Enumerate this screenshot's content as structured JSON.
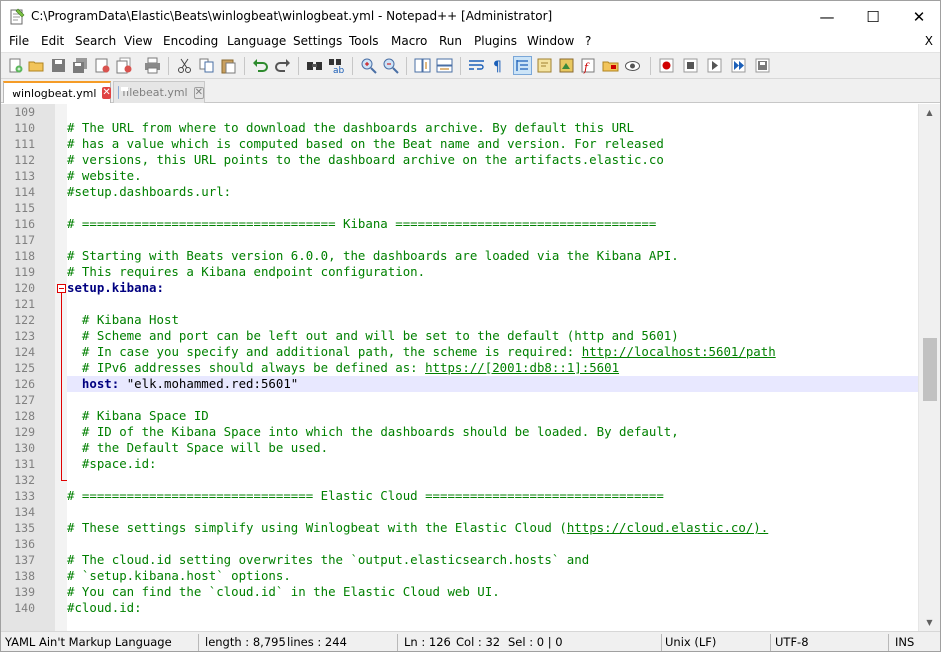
{
  "window": {
    "title": "C:\\ProgramData\\Elastic\\Beats\\winlogbeat\\winlogbeat.yml - Notepad++ [Administrator]",
    "minimize": "—",
    "maximize": "☐",
    "close": "✕"
  },
  "menu": {
    "items": [
      "File",
      "Edit",
      "Search",
      "View",
      "Encoding",
      "Language",
      "Settings",
      "Tools",
      "Macro",
      "Run",
      "Plugins",
      "Window",
      "?"
    ],
    "close": "X"
  },
  "toolbar": {
    "icons": [
      "new-file-icon",
      "open-file-icon",
      "save-icon",
      "save-all-icon",
      "close-icon",
      "close-all-icon",
      "print-icon",
      "cut-icon",
      "copy-icon",
      "paste-icon",
      "undo-icon",
      "redo-icon",
      "find-icon",
      "replace-icon",
      "zoom-in-icon",
      "zoom-out-icon",
      "sync-vertical-icon",
      "sync-horizontal-icon",
      "word-wrap-icon",
      "show-all-chars-icon",
      "indent-guide-icon",
      "define-language-icon",
      "document-map-icon",
      "function-list-icon",
      "folder-workspace-icon",
      "monitoring-icon",
      "record-macro-icon",
      "stop-macro-icon",
      "play-macro-icon",
      "run-macro-multiple-icon",
      "save-macro-icon"
    ]
  },
  "tabs": [
    {
      "label": "winlogbeat.yml",
      "active": true,
      "close": "✕"
    },
    {
      "label": "filebeat.yml",
      "active": false,
      "close": "✕"
    }
  ],
  "editor": {
    "current_line": 126,
    "lines": [
      {
        "n": "109",
        "parts": []
      },
      {
        "n": "110",
        "parts": [
          {
            "t": "cmt",
            "v": "# The URL from where to download the dashboards archive. By default this URL"
          }
        ]
      },
      {
        "n": "111",
        "parts": [
          {
            "t": "cmt",
            "v": "# has a value which is computed based on the Beat name and version. For released"
          }
        ]
      },
      {
        "n": "112",
        "parts": [
          {
            "t": "cmt",
            "v": "# versions, this URL points to the dashboard archive on the artifacts.elastic.co"
          }
        ]
      },
      {
        "n": "113",
        "parts": [
          {
            "t": "cmt",
            "v": "# website."
          }
        ]
      },
      {
        "n": "114",
        "parts": [
          {
            "t": "cmt",
            "v": "#setup.dashboards.url:"
          }
        ]
      },
      {
        "n": "115",
        "parts": []
      },
      {
        "n": "116",
        "parts": [
          {
            "t": "cmt",
            "v": "# ================================== Kibana ==================================="
          }
        ]
      },
      {
        "n": "117",
        "parts": []
      },
      {
        "n": "118",
        "parts": [
          {
            "t": "cmt",
            "v": "# Starting with Beats version 6.0.0, the dashboards are loaded via the Kibana API."
          }
        ]
      },
      {
        "n": "119",
        "parts": [
          {
            "t": "cmt",
            "v": "# This requires a Kibana endpoint configuration."
          }
        ]
      },
      {
        "n": "120",
        "parts": [
          {
            "t": "key",
            "v": "setup.kibana:"
          }
        ]
      },
      {
        "n": "121",
        "parts": []
      },
      {
        "n": "122",
        "parts": [
          {
            "t": "sp",
            "v": "  "
          },
          {
            "t": "cmt",
            "v": "# Kibana Host"
          }
        ]
      },
      {
        "n": "123",
        "parts": [
          {
            "t": "sp",
            "v": "  "
          },
          {
            "t": "cmt",
            "v": "# Scheme and port can be left out and will be set to the default (http and 5601)"
          }
        ]
      },
      {
        "n": "124",
        "parts": [
          {
            "t": "sp",
            "v": "  "
          },
          {
            "t": "cmt",
            "v": "# In case you specify and additional path, the scheme is required: "
          },
          {
            "t": "link",
            "v": "http://localhost:5601/path"
          }
        ]
      },
      {
        "n": "125",
        "parts": [
          {
            "t": "sp",
            "v": "  "
          },
          {
            "t": "cmt",
            "v": "# IPv6 addresses should always be defined as: "
          },
          {
            "t": "link",
            "v": "https://[2001:db8::1]:5601"
          }
        ]
      },
      {
        "n": "126",
        "parts": [
          {
            "t": "sp",
            "v": "  "
          },
          {
            "t": "key",
            "v": "host:"
          },
          {
            "t": "str",
            "v": " \"elk.mohammed.red:5601\""
          }
        ]
      },
      {
        "n": "127",
        "parts": []
      },
      {
        "n": "128",
        "parts": [
          {
            "t": "sp",
            "v": "  "
          },
          {
            "t": "cmt",
            "v": "# Kibana Space ID"
          }
        ]
      },
      {
        "n": "129",
        "parts": [
          {
            "t": "sp",
            "v": "  "
          },
          {
            "t": "cmt",
            "v": "# ID of the Kibana Space into which the dashboards should be loaded. By default,"
          }
        ]
      },
      {
        "n": "130",
        "parts": [
          {
            "t": "sp",
            "v": "  "
          },
          {
            "t": "cmt",
            "v": "# the Default Space will be used."
          }
        ]
      },
      {
        "n": "131",
        "parts": [
          {
            "t": "sp",
            "v": "  "
          },
          {
            "t": "cmt",
            "v": "#space.id:"
          }
        ]
      },
      {
        "n": "132",
        "parts": []
      },
      {
        "n": "133",
        "parts": [
          {
            "t": "cmt",
            "v": "# =============================== Elastic Cloud ================================"
          }
        ]
      },
      {
        "n": "134",
        "parts": []
      },
      {
        "n": "135",
        "parts": [
          {
            "t": "cmt",
            "v": "# These settings simplify using Winlogbeat with the Elastic Cloud ("
          },
          {
            "t": "link",
            "v": "https://cloud.elastic.co/)."
          }
        ]
      },
      {
        "n": "136",
        "parts": []
      },
      {
        "n": "137",
        "parts": [
          {
            "t": "cmt",
            "v": "# The cloud.id setting overwrites the `output.elasticsearch.hosts` and"
          }
        ]
      },
      {
        "n": "138",
        "parts": [
          {
            "t": "cmt",
            "v": "# `setup.kibana.host` options."
          }
        ]
      },
      {
        "n": "139",
        "parts": [
          {
            "t": "cmt",
            "v": "# You can find the `cloud.id` in the Elastic Cloud web UI."
          }
        ]
      },
      {
        "n": "140",
        "parts": [
          {
            "t": "cmt",
            "v": "#cloud.id:"
          }
        ]
      }
    ]
  },
  "scrollbar": {
    "up": "▲",
    "down": "▼"
  },
  "status": {
    "language": "YAML Ain't Markup Language",
    "length": "length : 8,795",
    "lines": "lines : 244",
    "ln": "Ln : 126",
    "col": "Col : 32",
    "sel": "Sel : 0 | 0",
    "eol": "Unix (LF)",
    "encoding": "UTF-8",
    "mode": "INS"
  }
}
